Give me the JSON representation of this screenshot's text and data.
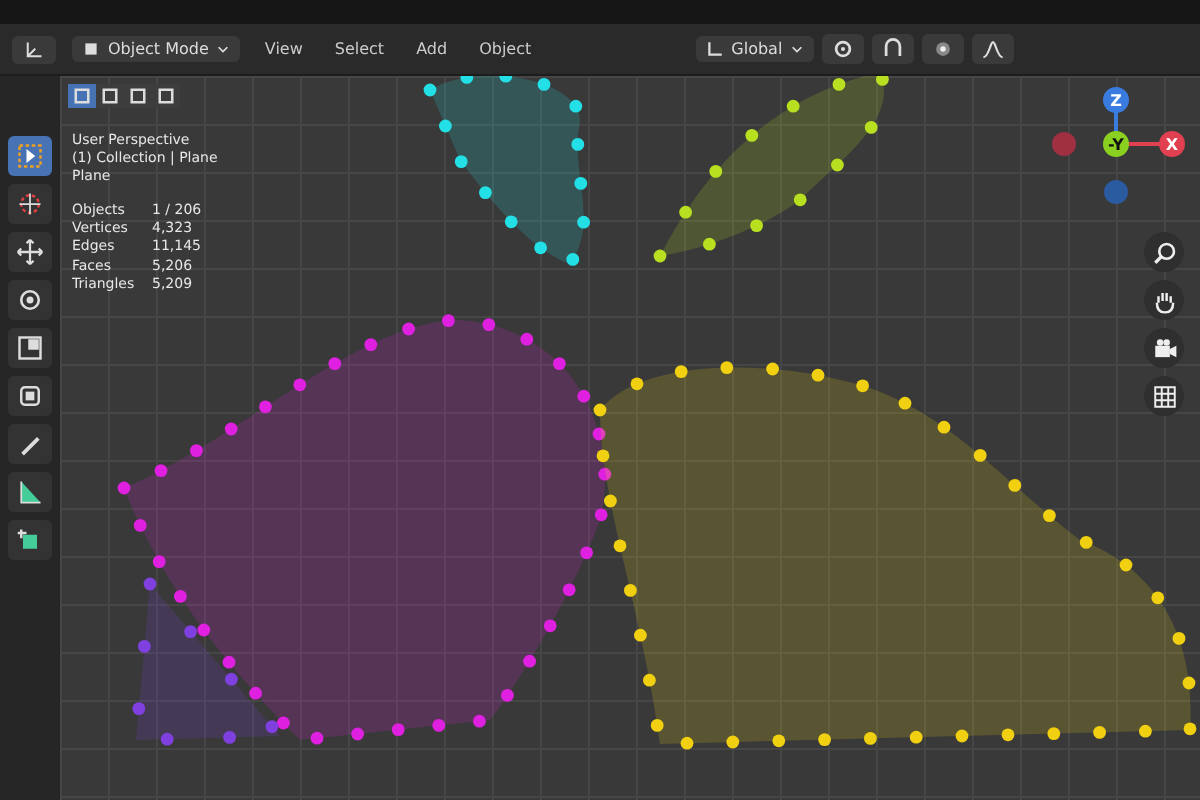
{
  "header": {
    "mode": "Object Mode",
    "menus": [
      "View",
      "Select",
      "Add",
      "Object"
    ],
    "orientation": "Global"
  },
  "select_modes": [
    {
      "selected": true
    },
    {
      "selected": false
    },
    {
      "selected": false
    },
    {
      "selected": false
    }
  ],
  "toolbar": [
    {
      "kind": "select",
      "selected": true
    },
    {
      "kind": "cursor",
      "selected": false
    },
    {
      "kind": "move",
      "selected": false
    },
    {
      "kind": "rotate",
      "selected": false
    },
    {
      "kind": "scale",
      "selected": false
    },
    {
      "kind": "transform",
      "selected": false
    },
    {
      "kind": "annotate",
      "selected": false
    },
    {
      "kind": "measure",
      "selected": false
    },
    {
      "kind": "add",
      "selected": false
    }
  ],
  "overlay": {
    "lines": [
      "User Perspective",
      "(1) Collection | Plane",
      "Plane"
    ],
    "stats": [
      {
        "label": "Objects",
        "value": "1 / 206"
      },
      {
        "label": "Vertices",
        "value": "4,323"
      },
      {
        "label": "Edges",
        "value": "11,145"
      },
      {
        "label": "Faces",
        "value": "5,206"
      },
      {
        "label": "Triangles",
        "value": "5,209"
      }
    ]
  },
  "gizmo": {
    "axes": [
      "Z",
      "-Y",
      "X"
    ]
  },
  "shapes": [
    {
      "color": "#22e0e6"
    },
    {
      "color": "#b8e020"
    },
    {
      "color": "#e020e0"
    },
    {
      "color": "#f0d010"
    },
    {
      "color": "#8040e0"
    }
  ]
}
